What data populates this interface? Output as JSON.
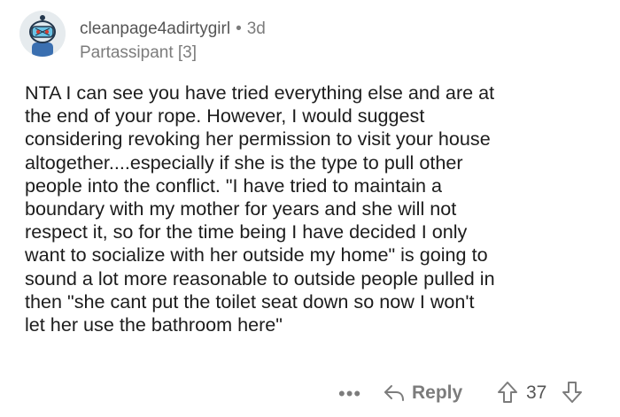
{
  "comment": {
    "author": "cleanpage4adirtygirl",
    "separator": "•",
    "age": "3d",
    "flair": "Partassipant [3]",
    "avatar_icon": "snoo-avatar-icon",
    "body_lines": [
      "NTA I can see you have tried everything else and are at",
      "the end of your rope. However, I would suggest",
      "considering revoking her permission to visit your house",
      "altogether....especially if she is the type to pull other",
      "people into the conflict. \"I have tried to maintain a",
      "boundary with my mother for years and she will not",
      "respect it, so for the time being I have decided I only",
      "want to socialize with her outside my home\" is going to",
      "sound a lot more reasonable to outside people pulled in",
      "then \"she cant put the toilet seat down so now I won't",
      "let her use the bathroom here\""
    ]
  },
  "actions": {
    "more_label": "•••",
    "reply_label": "Reply",
    "score": "37",
    "reply_icon": "reply-arrow-icon",
    "upvote_icon": "upvote-arrow-icon",
    "downvote_icon": "downvote-arrow-icon"
  }
}
